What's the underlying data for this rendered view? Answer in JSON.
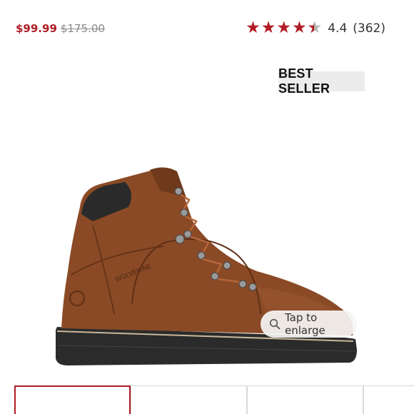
{
  "product": {
    "sale_price": "$99.99",
    "original_price": "$175.00",
    "badge": "BEST SELLER",
    "rating_value": "4.4",
    "rating_count": "(362)",
    "rating_fraction": 0.88,
    "brand_mark": "WOLVERINE"
  },
  "gallery": {
    "enlarge_label": "Tap to enlarge",
    "thumbnail_count": 4,
    "active_thumbnail": 1
  },
  "colors": {
    "accent": "#b01c22",
    "leather": "#8a4a26",
    "sole": "#2b2b2b"
  }
}
